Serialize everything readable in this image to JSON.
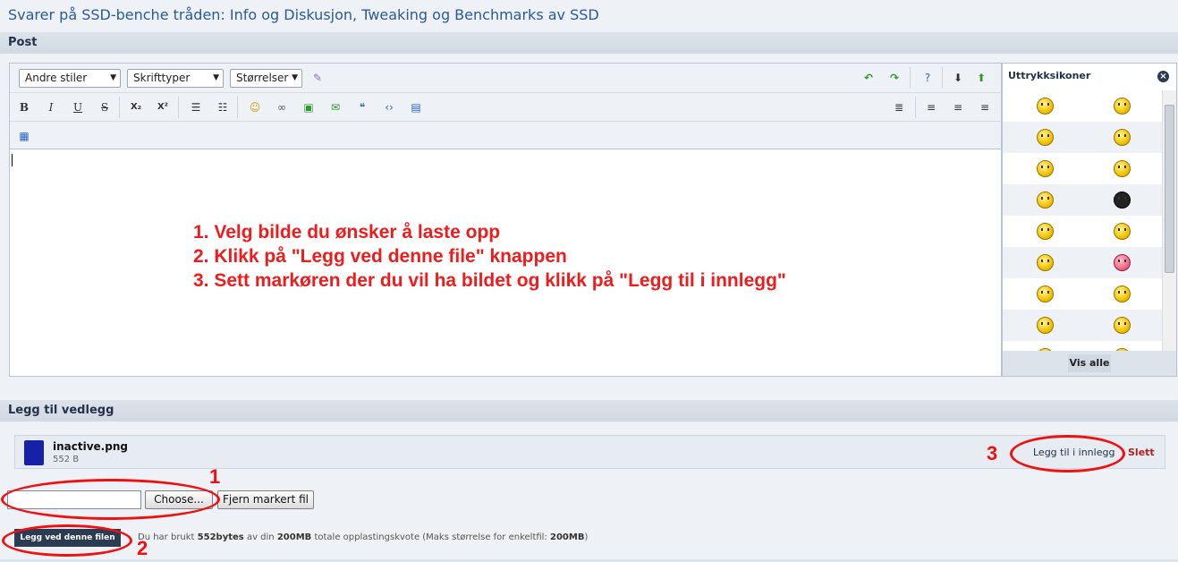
{
  "page": {
    "title": "Svarer på SSD-benche tråden: Info og Diskusjon, Tweaking og Benchmarks av SSD"
  },
  "post_section": {
    "label": "Post"
  },
  "toolbar": {
    "styles_select": "Andre stiler",
    "fonts_select": "Skrifttyper",
    "sizes_select": "Størrelser",
    "bold": "B",
    "italic": "I",
    "underline": "U",
    "strike": "S",
    "subscript": "X₂",
    "superscript": "X²"
  },
  "instructions": [
    "1. Velg bilde du ønsker å laste opp",
    "2. Klikk på \"Legg ved denne file\" knappen",
    "3. Sett markøren der du vil ha bildet og klikk på \"Legg til i innlegg\""
  ],
  "smilies": {
    "title": "Uttrykksikoner",
    "show_all": "Vis alle",
    "rows": 9
  },
  "attachments": {
    "section_label": "Legg til vedlegg",
    "file": {
      "name": "inactive.png",
      "size": "552 B",
      "insert_label": "Legg til i innlegg",
      "delete_label": "Slett"
    },
    "choose_label": "Choose...",
    "remove_label": "Fjern markert fil",
    "upload_label": "Legg ved denne filen",
    "quota": {
      "prefix": "Du har brukt",
      "used": "552bytes",
      "middle": "av din",
      "total": "200MB",
      "suffix": "totale opplastingskvote (Maks størrelse for enkeltfil:",
      "max": "200MB",
      "end": ")"
    }
  },
  "annotations": {
    "one": "1",
    "two": "2",
    "three": "3"
  },
  "colors": {
    "annotation": "#ee1111",
    "header_text": "#2a5a9a",
    "upload_button": "#2b3b52"
  }
}
